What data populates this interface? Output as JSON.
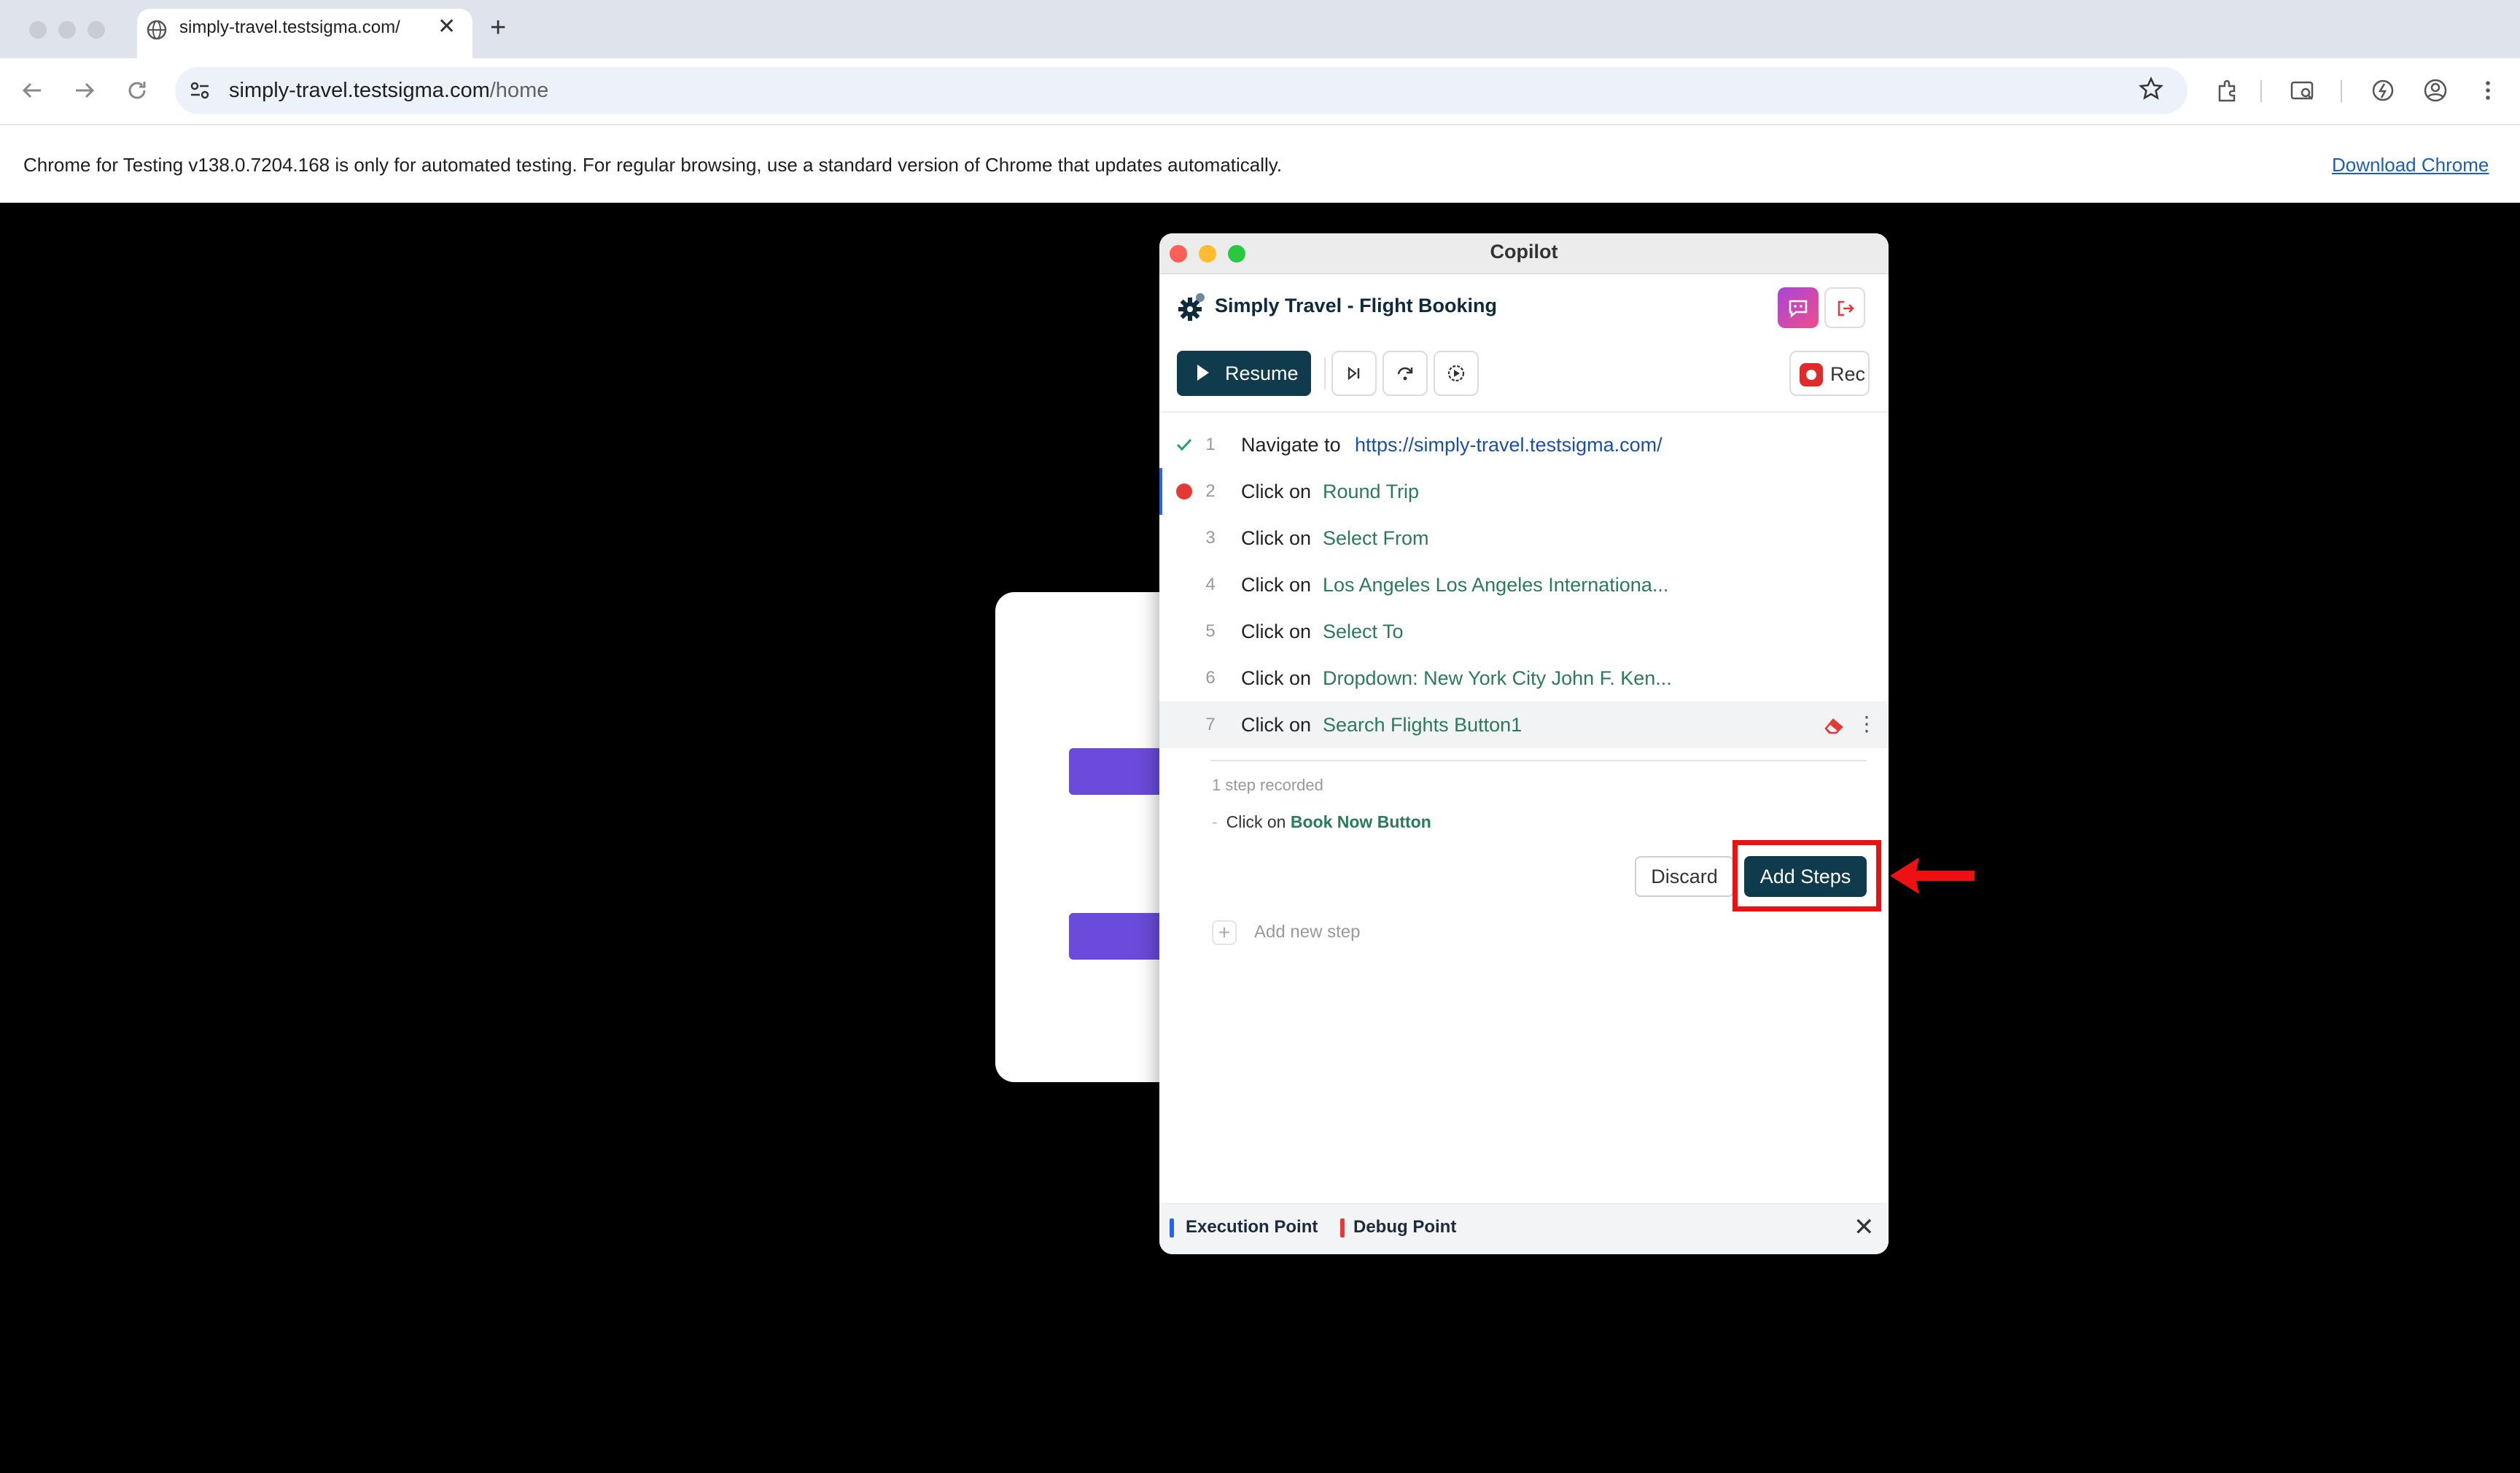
{
  "browser": {
    "tab_title": "simply-travel.testsigma.com/",
    "new_tab_symbol": "+",
    "close_symbol": "✕",
    "url_host": "simply-travel.testsigma.com",
    "url_path": "/home",
    "info_text": "Chrome for Testing v138.0.7204.168 is only for automated testing. For regular browsing, use a standard version of Chrome that updates automatically.",
    "info_link": "Download Chrome"
  },
  "copilot": {
    "window_title": "Copilot",
    "project_name": "Simply Travel - Flight Booking",
    "controls": {
      "resume_label": "Resume",
      "rec_label": "Rec"
    },
    "steps": [
      {
        "num": "1",
        "action": "Navigate to",
        "target": "https://simply-travel.testsigma.com/",
        "status": "passed"
      },
      {
        "num": "2",
        "action": "Click on",
        "target": "Round Trip",
        "status": "debug-point"
      },
      {
        "num": "3",
        "action": "Click on",
        "target": "Select From",
        "status": ""
      },
      {
        "num": "4",
        "action": "Click on",
        "target": "Los Angeles Los Angeles Internationa...",
        "status": ""
      },
      {
        "num": "5",
        "action": "Click on",
        "target": "Select To",
        "status": ""
      },
      {
        "num": "6",
        "action": "Click on",
        "target": "Dropdown: New York City John F. Ken...",
        "status": ""
      },
      {
        "num": "7",
        "action": "Click on",
        "target": "Search Flights Button1",
        "status": "hovered"
      }
    ],
    "recorded": {
      "count_text": "1 step recorded",
      "dash": "-",
      "item_action": "Click on",
      "item_target": "Book Now Button"
    },
    "actions": {
      "discard_label": "Discard",
      "add_steps_label": "Add Steps"
    },
    "add_new_step": {
      "plus": "+",
      "label": "Add new step"
    },
    "footer": {
      "execution_point": "Execution Point",
      "debug_point": "Debug Point",
      "close_symbol": "✕"
    }
  },
  "colors": {
    "primary": "#0f3b4c",
    "target_text": "#2b7a5a",
    "debug_red": "#e53935",
    "execution_blue": "#2563eb",
    "highlight_red": "#ee1111"
  }
}
